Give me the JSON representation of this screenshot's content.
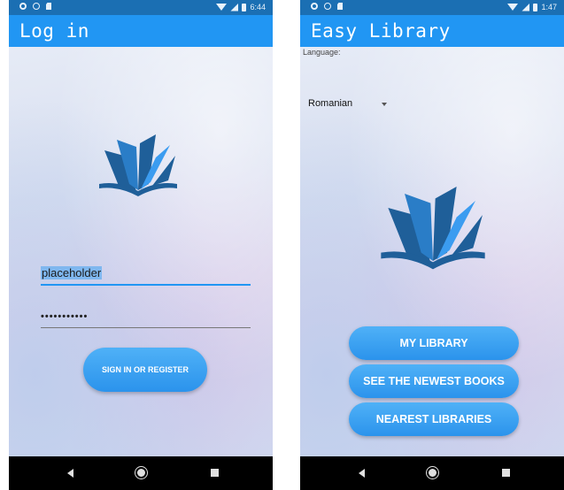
{
  "left_screen": {
    "status_time": "6:44",
    "title": "Log in",
    "username_value": "placeholder",
    "password_value": "•••••••••••",
    "signin_label": "SIGN IN OR REGISTER"
  },
  "right_screen": {
    "status_time": "1:47",
    "title": "Easy Library",
    "language_label": "Language:",
    "language_value": "Romanian",
    "buttons": [
      {
        "label": "MY LIBRARY"
      },
      {
        "label": "SEE THE NEWEST BOOKS"
      },
      {
        "label": "NEAREST LIBRARIES"
      }
    ]
  },
  "colors": {
    "app_bar": "#2196f3",
    "status_bar": "#1b6fb3",
    "button": "#3aa1f2",
    "logo_dark": "#1f5f99",
    "logo_light": "#3b9cf0"
  }
}
